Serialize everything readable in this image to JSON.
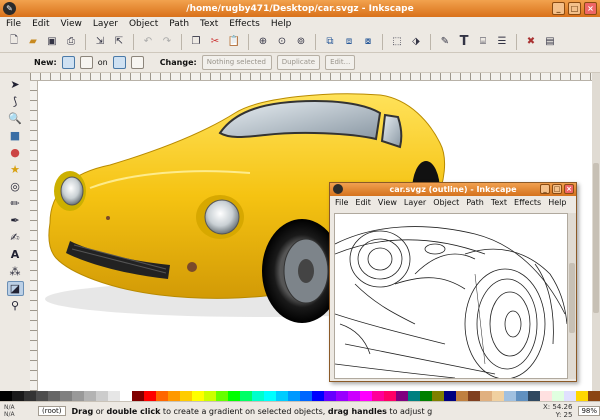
{
  "window": {
    "title": "/home/rugby471/Desktop/car.svgz - Inkscape"
  },
  "menu": [
    "File",
    "Edit",
    "View",
    "Layer",
    "Object",
    "Path",
    "Text",
    "Effects",
    "Help"
  ],
  "toolbar_icons": [
    "new-icon",
    "open-icon",
    "save-icon",
    "print-icon",
    "import-icon",
    "export-icon",
    "undo-icon",
    "redo-icon",
    "copy-icon",
    "cut-icon",
    "paste-icon",
    "zoom-selection-icon",
    "zoom-drawing-icon",
    "zoom-page-icon",
    "duplicate-icon",
    "clone-icon",
    "unlink-clone-icon",
    "group-icon",
    "ungroup-icon",
    "fill-stroke-icon",
    "text-font-icon",
    "xml-editor-icon",
    "align-icon",
    "preferences-icon",
    "document-properties-icon"
  ],
  "controls": {
    "new_label": "New:",
    "on_label": "on",
    "change_label": "Change:",
    "selection_box": "Nothing selected",
    "duplicate_btn": "Duplicate",
    "edit_btn": "Edit..."
  },
  "tools": [
    "selector-tool-icon",
    "node-tool-icon",
    "zoom-tool-icon",
    "rectangle-tool-icon",
    "ellipse-tool-icon",
    "star-tool-icon",
    "spiral-tool-icon",
    "pencil-tool-icon",
    "pen-tool-icon",
    "calligraphy-tool-icon",
    "text-tool-icon",
    "spray-tool-icon",
    "gradient-tool-icon",
    "dropper-tool-icon"
  ],
  "inner_window": {
    "title": "car.svgz (outline) - Inkscape",
    "menu": [
      "File",
      "Edit",
      "View",
      "Layer",
      "Object",
      "Path",
      "Text",
      "Effects",
      "Help"
    ]
  },
  "status": {
    "fill_label": "N/A",
    "stroke_label": "N/A",
    "layer": "(root)",
    "message_bold1": "Drag",
    "message_mid1": " or ",
    "message_bold2": "double click",
    "message_mid2": " to create a gradient on selected objects, ",
    "message_bold3": "drag handles",
    "message_end": " to adjust g",
    "coord_x": "X: 54.26",
    "coord_y": "Y: 25",
    "zoom": "98%"
  },
  "palette": [
    "#000000",
    "#1a1a1a",
    "#333333",
    "#4d4d4d",
    "#666666",
    "#808080",
    "#999999",
    "#b3b3b3",
    "#cccccc",
    "#e6e6e6",
    "#ffffff",
    "#800000",
    "#ff0000",
    "#ff6600",
    "#ff9900",
    "#ffcc00",
    "#ffff00",
    "#ccff00",
    "#66ff00",
    "#00ff00",
    "#00ff66",
    "#00ffcc",
    "#00ffff",
    "#00ccff",
    "#0099ff",
    "#0066ff",
    "#0000ff",
    "#6600ff",
    "#9900ff",
    "#cc00ff",
    "#ff00ff",
    "#ff0099",
    "#ff0066",
    "#800080",
    "#008080",
    "#008000",
    "#808000",
    "#000080",
    "#c08040",
    "#804020",
    "#e0b080",
    "#f0d0a0",
    "#a0c0e0",
    "#6090c0",
    "#304860",
    "#ffe0e0",
    "#e0ffe0",
    "#e0e0ff",
    "#ffd700",
    "#8b4513"
  ]
}
